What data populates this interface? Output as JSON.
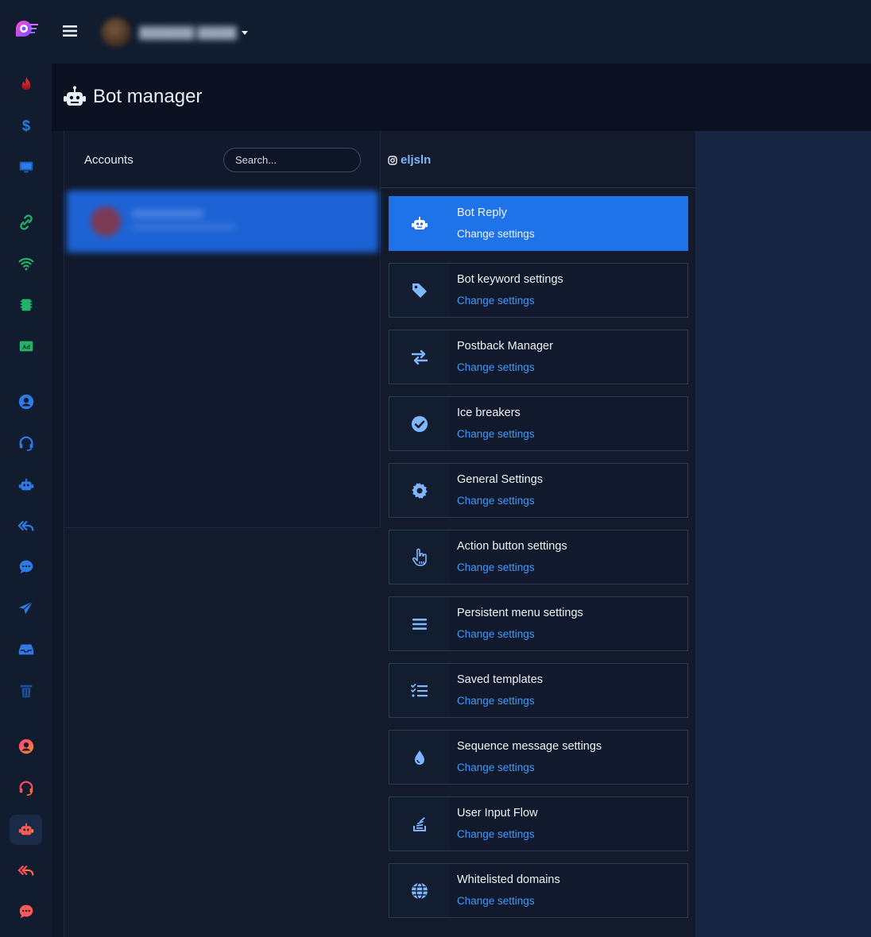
{
  "page": {
    "title": "Bot manager"
  },
  "accounts": {
    "title": "Accounts",
    "search_placeholder": "Search..."
  },
  "profile": {
    "handle": "eljsln"
  },
  "settings": [
    {
      "title": "Bot Reply",
      "link": "Change settings",
      "icon": "robot-icon"
    },
    {
      "title": "Bot keyword settings",
      "link": "Change settings",
      "icon": "tag-icon"
    },
    {
      "title": "Postback Manager",
      "link": "Change settings",
      "icon": "exchange-icon"
    },
    {
      "title": "Ice breakers",
      "link": "Change settings",
      "icon": "check-circle-icon"
    },
    {
      "title": "General Settings",
      "link": "Change settings",
      "icon": "gear-icon"
    },
    {
      "title": "Action button settings",
      "link": "Change settings",
      "icon": "hand-pointer-icon"
    },
    {
      "title": "Persistent menu settings",
      "link": "Change settings",
      "icon": "bars-icon"
    },
    {
      "title": "Saved templates",
      "link": "Change settings",
      "icon": "list-check-icon"
    },
    {
      "title": "Sequence message settings",
      "link": "Change settings",
      "icon": "droplet-icon"
    },
    {
      "title": "User Input Flow",
      "link": "Change settings",
      "icon": "stack-icon"
    },
    {
      "title": "Whitelisted domains",
      "link": "Change settings",
      "icon": "globe-icon"
    }
  ],
  "sidebar_icons": [
    "fire-icon",
    "dollar-icon",
    "display-icon",
    "link-icon",
    "wifi-icon",
    "chip-icon",
    "ad-icon",
    "user-circle-icon",
    "headset-icon",
    "robot-icon",
    "reply-all-icon",
    "comment-dots-icon",
    "paper-plane-icon",
    "inbox-icon",
    "trash-icon",
    "user-circle-icon",
    "headset-icon",
    "robot-icon",
    "reply-all-icon",
    "comment-dots-icon"
  ],
  "colors": {
    "accent": "#1f73e8",
    "link": "#3d9bff",
    "background": "#0f1729"
  }
}
